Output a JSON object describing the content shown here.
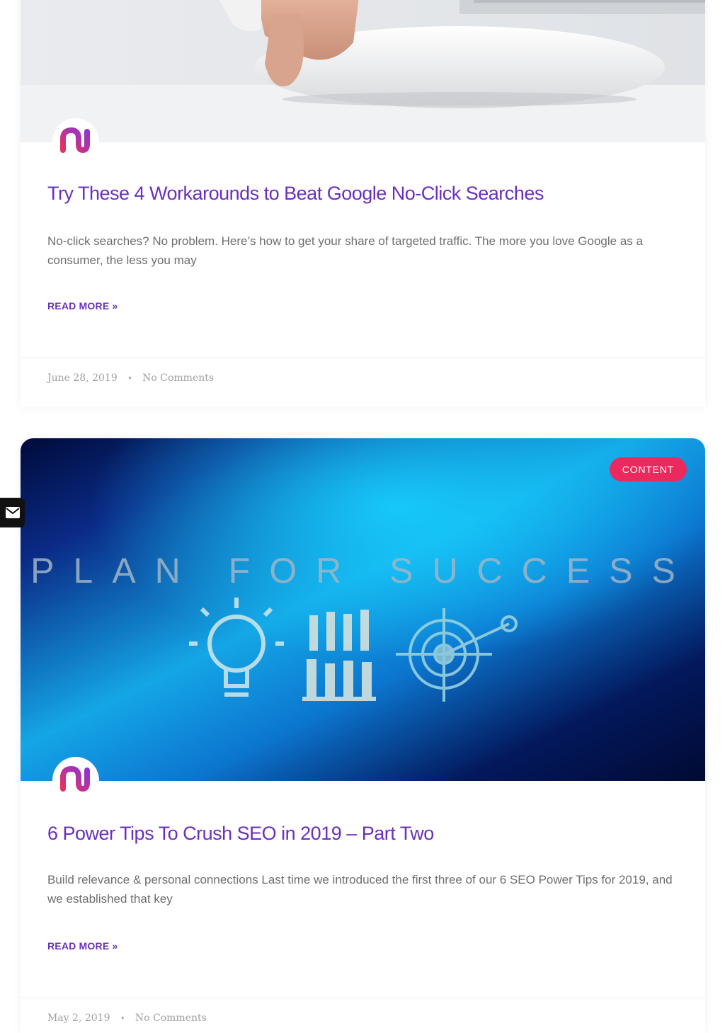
{
  "posts": [
    {
      "title": "Try These 4 Workarounds to Beat Google No-Click Searches",
      "excerpt": "No-click searches? No problem. Here’s how to get your share of targeted traffic. The more you love Google as a consumer, the less you may",
      "read_more": "READ MORE »",
      "date": "June 28, 2019",
      "separator": "•",
      "comments": "No Comments",
      "thumbnail_icon": "hand-on-mouse-photo"
    },
    {
      "category": "CONTENT",
      "thumbnail_text": "PLAN FOR SUCCESS",
      "title": "6 Power Tips To Crush SEO in 2019 – Part Two",
      "excerpt": "Build relevance & personal connections Last time we introduced the first three of our 6 SEO Power Tips for 2019, and we established that key",
      "read_more": "READ MORE »",
      "date": "May 2, 2019",
      "separator": "•",
      "comments": "No Comments",
      "thumbnail_icon": "plan-for-success-illustration"
    }
  ],
  "avatar_icon": "brand-s-logo",
  "side_widget_icon": "envelope-icon",
  "colors": {
    "title": "#6a2fbf",
    "badge": "#ea2a5e",
    "excerpt": "#6e6e6e",
    "meta": "#a0a0a0"
  }
}
